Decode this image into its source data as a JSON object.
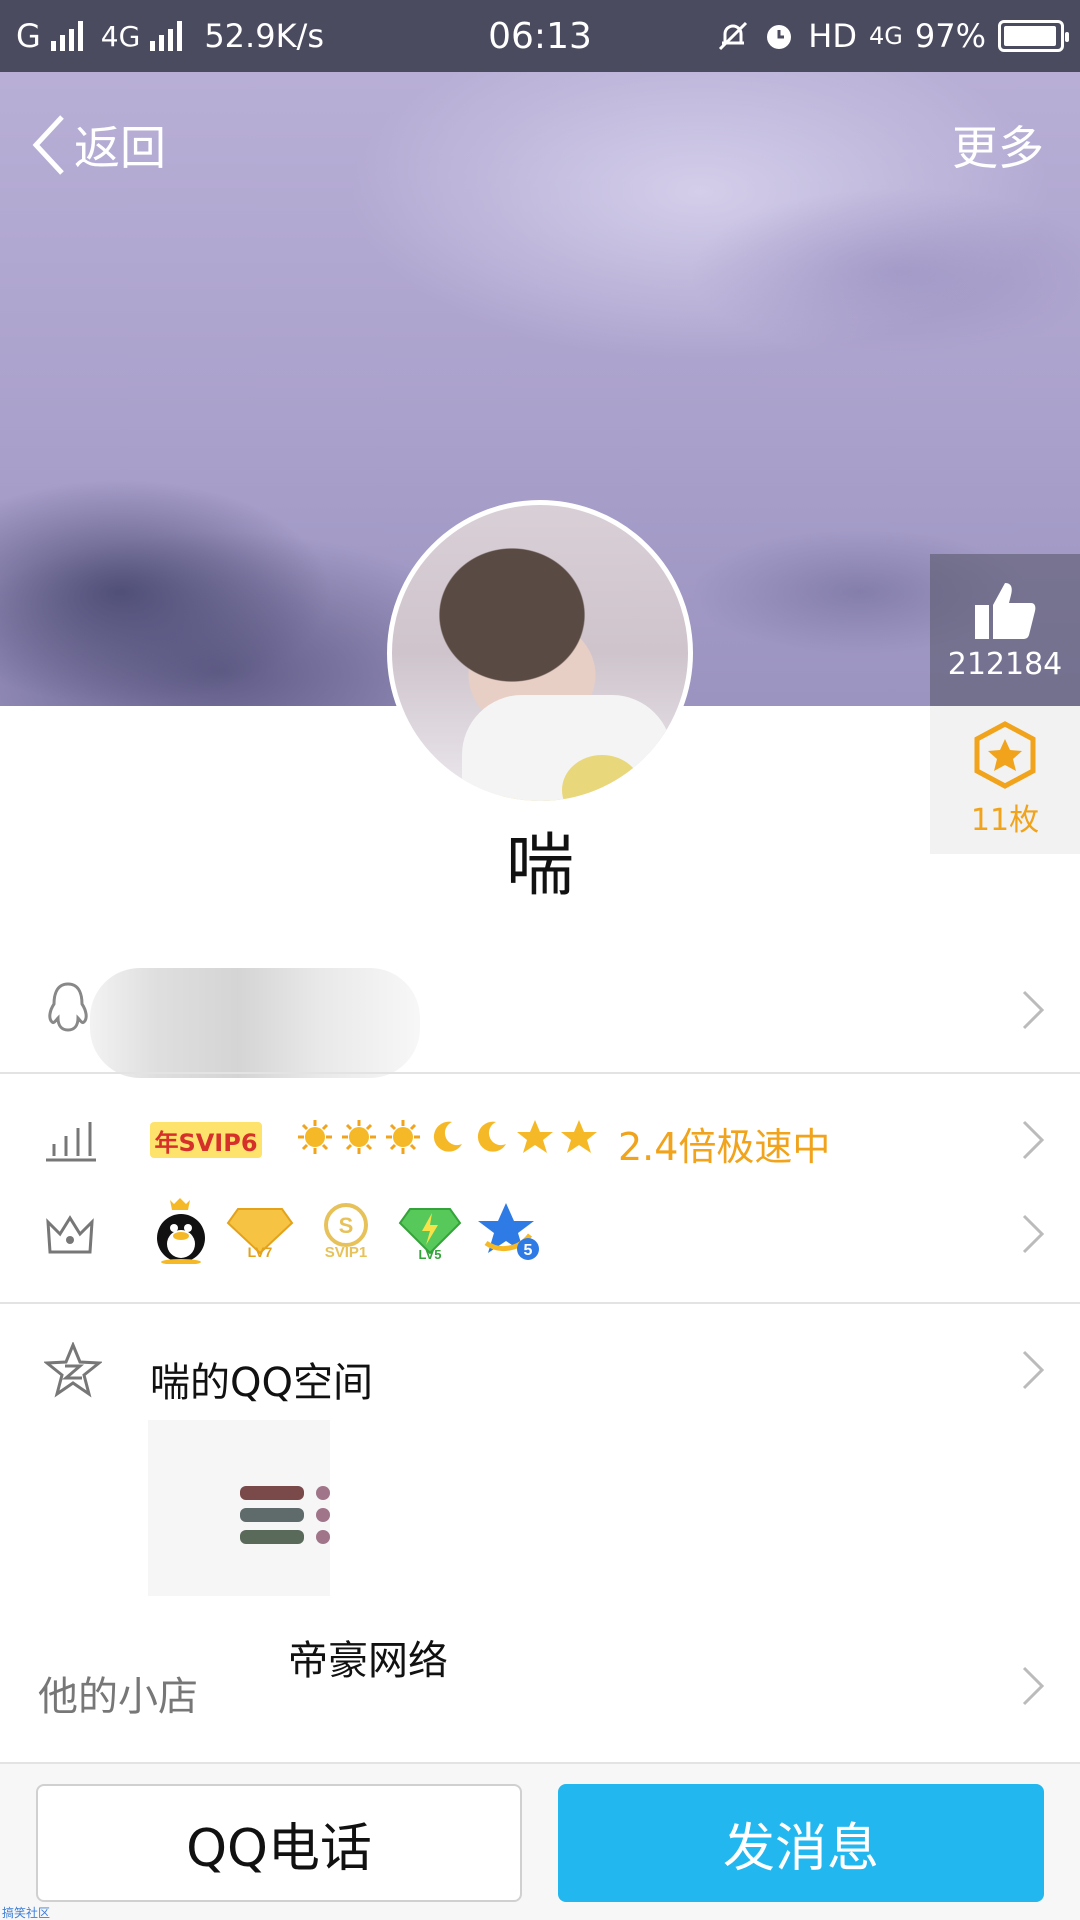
{
  "status_bar": {
    "carrier1": "G",
    "network": "4G",
    "speed": "52.9K/s",
    "time": "06:13",
    "hd": "HD",
    "net2": "4G",
    "battery": "97%"
  },
  "header": {
    "back_label": "返回",
    "more_label": "更多"
  },
  "stats": {
    "likes": "212184",
    "medals": "11枚"
  },
  "profile": {
    "nickname": "喘"
  },
  "levels": {
    "svip_badge": "年SVIP6",
    "speed_text": "2.4倍极速中",
    "level_icons": [
      "sun-icon",
      "sun-icon",
      "sun-icon",
      "moon-icon",
      "moon-icon",
      "star-icon",
      "star-icon"
    ]
  },
  "vip_badges": {
    "items": [
      "QQ",
      "LV7",
      "SVIP1",
      "LV5",
      "5"
    ]
  },
  "qzone": {
    "label": "喘的QQ空间"
  },
  "shop": {
    "name": "帝豪网络",
    "label": "他的小店"
  },
  "actions": {
    "call_label": "QQ电话",
    "message_label": "发消息"
  },
  "watermark": "搞笑社区",
  "colors": {
    "accent_orange": "#f0a31b",
    "message_blue": "#22b7ef",
    "status_bar": "#4b4b60"
  }
}
